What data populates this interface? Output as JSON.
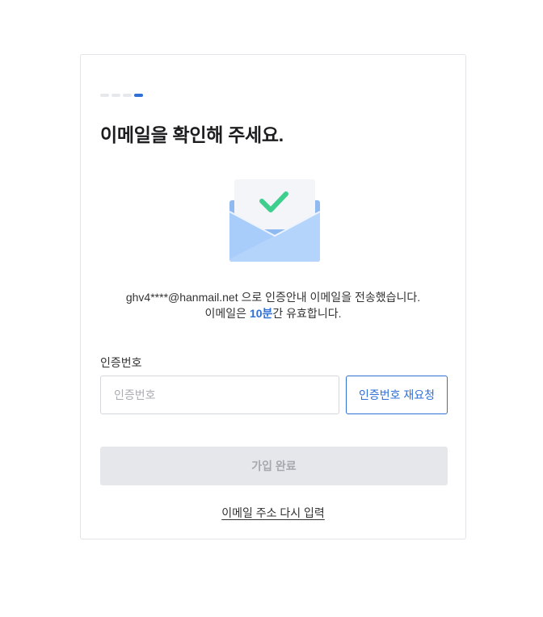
{
  "progress": {
    "total_steps": 4,
    "current_step": 4
  },
  "title": "이메일을 확인해 주세요.",
  "illustration": {
    "icon": "envelope-check-icon",
    "check_color": "#3ecf8e",
    "envelope_color": "#a7c9f7"
  },
  "notice": {
    "line1": "ghv4****@hanmail.net 으로 인증안내 이메일을 전송했습니다.",
    "line2_prefix": "이메일은 ",
    "line2_highlight": "10분",
    "line2_suffix": "간 유효합니다."
  },
  "verification": {
    "label": "인증번호",
    "placeholder": "인증번호",
    "value": "",
    "resend_label": "인증번호 재요청"
  },
  "submit_label": "가입 완료",
  "reenter_email_label": "이메일 주소 다시 입력",
  "colors": {
    "accent": "#2f6fd6",
    "disabled_bg": "#e6e7ea",
    "disabled_text": "#a5a8ae"
  }
}
